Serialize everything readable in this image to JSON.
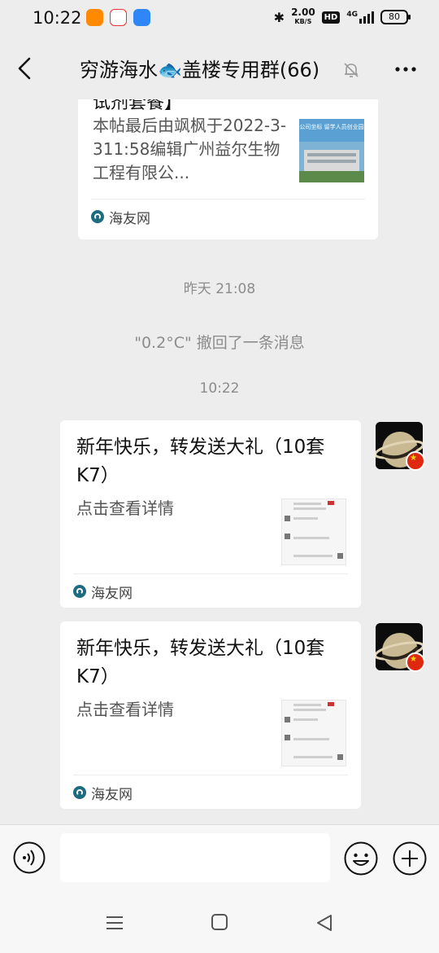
{
  "status_bar": {
    "time": "10:22",
    "net_speed": "2.00",
    "net_unit": "KB/S",
    "hd_label": "HD",
    "signal_label": "4G",
    "battery": "80",
    "app_icons": [
      "taobao-app-icon",
      "tmall-app-icon",
      "messenger-app-icon"
    ]
  },
  "header": {
    "title": "穷游海水🐟盖楼专用群(66)",
    "back_icon": "chevron-left-icon",
    "mute_icon": "bell-off-icon",
    "more_icon": "more-dots-icon"
  },
  "chat": {
    "top_card": {
      "title_tail": "试剂套餐】",
      "description": "本帖最后由飒枫于2022-3-311:58编辑广州益尔生物工程有限公...",
      "thumb_text": "公司坐标 留学人员创业园",
      "source": "海友网"
    },
    "system_time_1": "昨天 21:08",
    "recall_notice": "\"0.2°C\" 撤回了一条消息",
    "system_time_2": "10:22",
    "messages": [
      {
        "title": "新年快乐，转发送大礼（10套K7）",
        "description": "点击查看详情",
        "source": "海友网"
      },
      {
        "title": "新年快乐，转发送大礼（10套K7）",
        "description": "点击查看详情",
        "source": "海友网"
      }
    ]
  },
  "input_bar": {
    "placeholder": ""
  },
  "colors": {
    "background": "#ededed",
    "card": "#ffffff",
    "system_text": "#8c8c8c",
    "source_icon": "#1d6b7f"
  }
}
